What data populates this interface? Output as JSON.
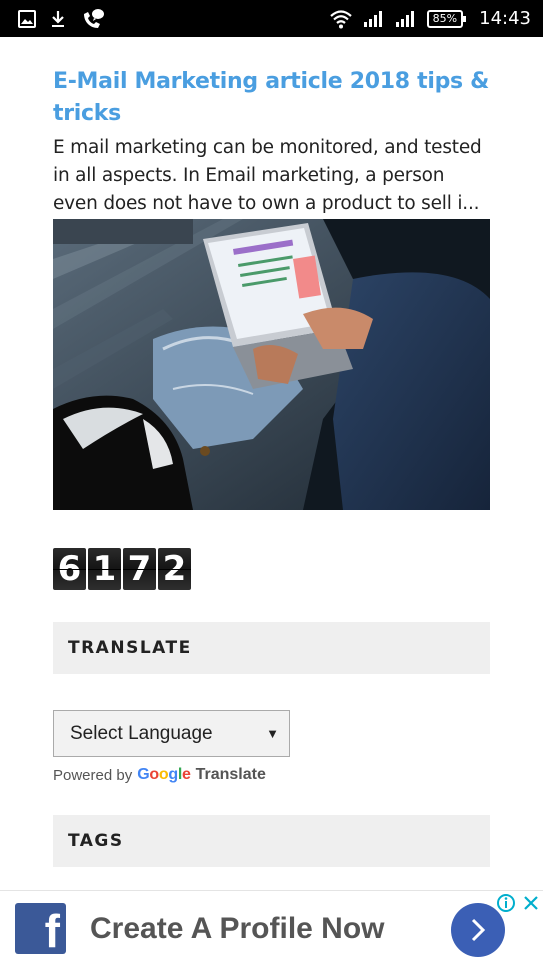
{
  "status_bar": {
    "battery": "85%",
    "time": "14:43",
    "icons": [
      "image-icon",
      "download-icon",
      "call-icon",
      "wifi-icon",
      "signal-icon",
      "signal-icon",
      "battery-icon"
    ]
  },
  "article": {
    "title": "E-Mail Marketing article 2018 tips & tricks",
    "excerpt": "E mail marketing can be monitored, and tested in all aspects. In Email marketing, a person even does not have to own a product to sell i..."
  },
  "counter": {
    "digits": [
      "6",
      "1",
      "7",
      "2"
    ]
  },
  "translate_widget": {
    "title": "TRANSLATE",
    "select_value": "Select Language",
    "powered_by": "Powered by",
    "google_letters": [
      "G",
      "o",
      "o",
      "g",
      "l",
      "e"
    ],
    "translate_word": "Translate"
  },
  "tags_widget": {
    "title": "TAGS"
  },
  "ad": {
    "brand_icon": "facebook-icon",
    "text": "Create A Profile Now",
    "colors": {
      "facebook": "#3b5998",
      "button": "#3b5fb5",
      "ad_choices": "#00aecd"
    }
  },
  "colors": {
    "title_link": "#4a9ee0",
    "widget_bg": "#efefef"
  }
}
